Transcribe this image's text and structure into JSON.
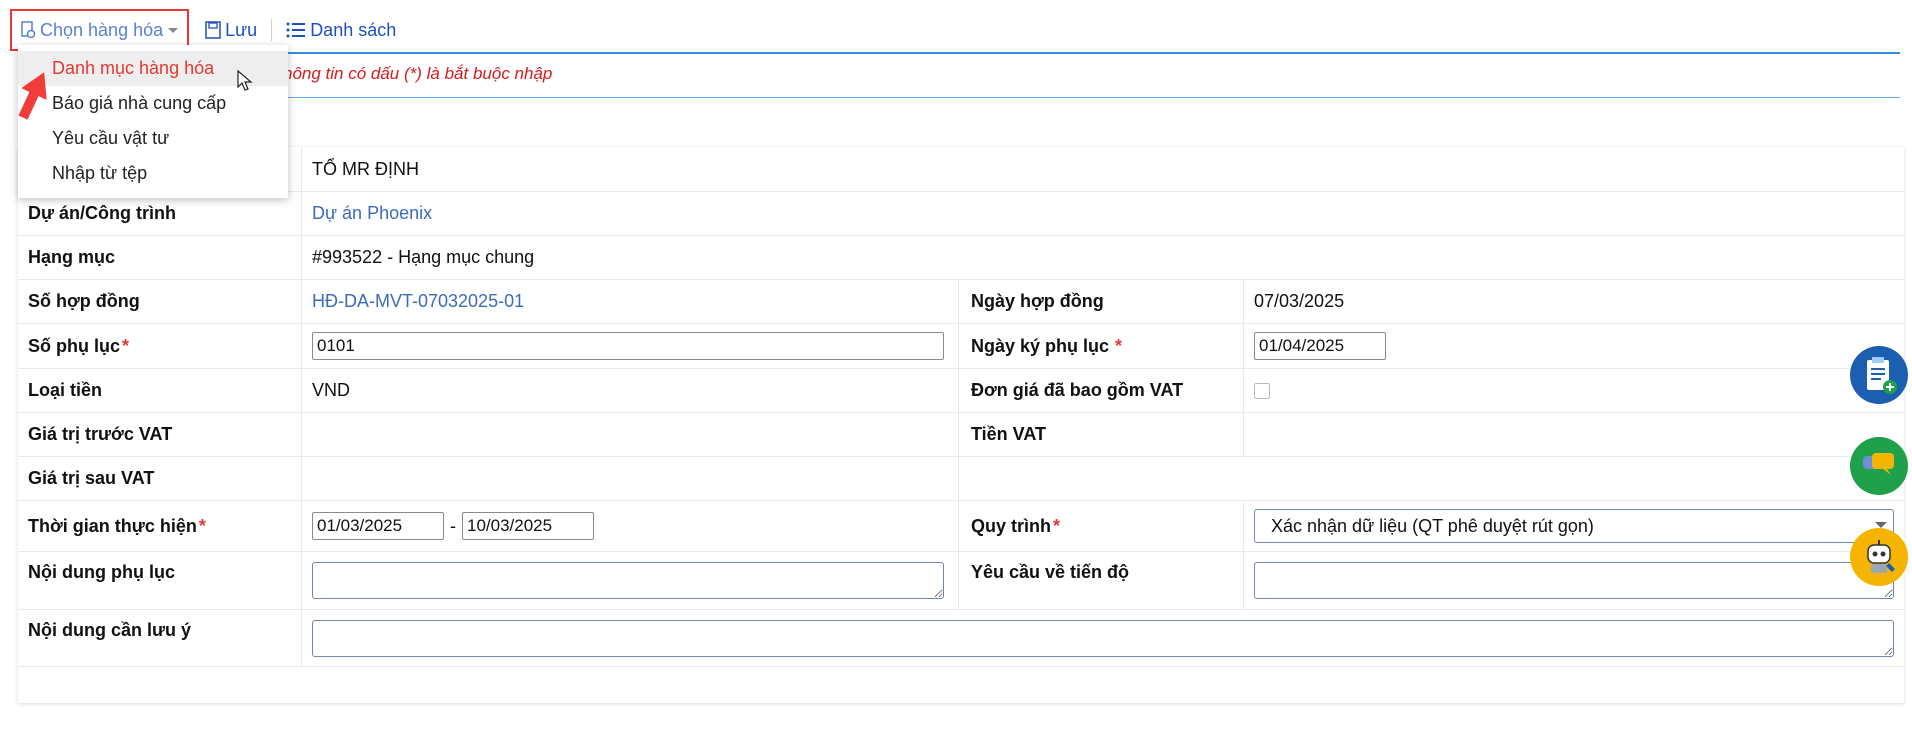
{
  "toolbar": {
    "choose_label": "Chọn hàng hóa",
    "save_label": "Lưu",
    "list_label": "Danh sách"
  },
  "note": "hông tin có dấu (*) là bắt buộc nhập",
  "dropdown": {
    "items": [
      {
        "label": "Danh mục hàng hóa"
      },
      {
        "label": "Báo giá nhà cung cấp"
      },
      {
        "label": "Yêu cầu vật tư"
      },
      {
        "label": "Nhập từ tệp"
      }
    ]
  },
  "form": {
    "row0": {
      "value": "TỔ MR ĐỊNH"
    },
    "project": {
      "label": "Dự án/Công trình",
      "value": "Dự án Phoenix"
    },
    "category": {
      "label": "Hạng mục",
      "value": "#993522 - Hạng mục chung"
    },
    "contract_no": {
      "label": "Số hợp đồng",
      "value": "HĐ-DA-MVT-07032025-01"
    },
    "contract_date": {
      "label": "Ngày hợp đồng",
      "value": "07/03/2025"
    },
    "appendix_no": {
      "label": "Số phụ lục",
      "required": "*",
      "value": "0101"
    },
    "appendix_sign_date": {
      "label": "Ngày ký phụ lục",
      "required": "*",
      "value": "01/04/2025"
    },
    "currency": {
      "label": "Loại tiền",
      "value": "VND"
    },
    "price_incl_vat": {
      "label": "Đơn giá đã bao gồm VAT"
    },
    "value_before_vat": {
      "label": "Giá trị trước VAT"
    },
    "vat_amount": {
      "label": "Tiền VAT"
    },
    "value_after_vat": {
      "label": "Giá trị sau VAT"
    },
    "period": {
      "label": "Thời gian thực hiện",
      "required": "*",
      "from": "01/03/2025",
      "sep": "-",
      "to": "10/03/2025"
    },
    "workflow": {
      "label": "Quy trình",
      "required": "*",
      "value": "Xác nhận dữ liệu (QT phê duyệt rút gọn)"
    },
    "appendix_content": {
      "label": "Nội dung phụ lục"
    },
    "progress_req": {
      "label": "Yêu cầu về tiến độ"
    },
    "notes": {
      "label": "Nội dung cần lưu ý"
    }
  },
  "colors": {
    "accent": "#1f4fc4",
    "required": "#e53935",
    "link": "#3c6cb8"
  }
}
